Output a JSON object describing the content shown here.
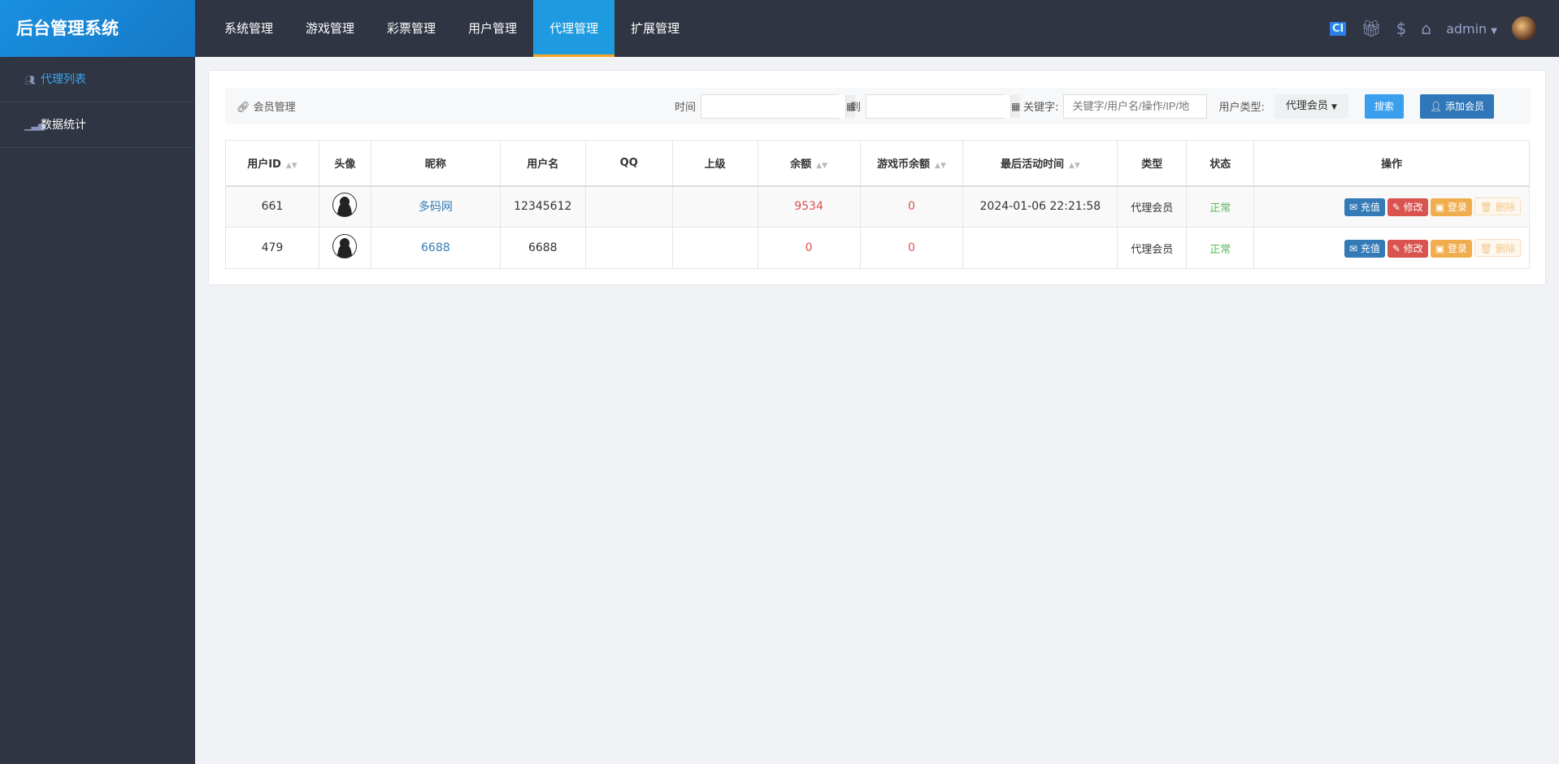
{
  "app_title": "后台管理系统",
  "nav": [
    "系统管理",
    "游戏管理",
    "彩票管理",
    "用户管理",
    "代理管理",
    "扩展管理"
  ],
  "nav_active": 4,
  "header": {
    "ci_label": "CI",
    "user": "admin"
  },
  "sidebar": {
    "items": [
      {
        "label": "代理列表",
        "icon": "users-icon"
      },
      {
        "label": "数据统计",
        "icon": "signal-icon"
      }
    ]
  },
  "toolbar": {
    "title": "会员管理",
    "time_label": "时间",
    "to_label": "到",
    "keyword_label": "关键字:",
    "keyword_placeholder": "关键字/用户名/操作/IP/地",
    "type_label": "用户类型:",
    "type_value": "代理会员",
    "search": "搜索",
    "add": "添加会员"
  },
  "table": {
    "headers": [
      "用户ID",
      "头像",
      "昵称",
      "用户名",
      "QQ",
      "上级",
      "余额",
      "游戏币余额",
      "最后活动时间",
      "类型",
      "状态",
      "操作"
    ],
    "rows": [
      {
        "id": "661",
        "nick": "多码网",
        "username": "12345612",
        "qq": "",
        "parent": "",
        "balance": "9534",
        "coin": "0",
        "last": "2024-01-06 22:21:58",
        "type": "代理会员",
        "status": "正常"
      },
      {
        "id": "479",
        "nick": "6688",
        "username": "6688",
        "qq": "",
        "parent": "",
        "balance": "0",
        "coin": "0",
        "last": "",
        "type": "代理会员",
        "status": "正常"
      }
    ],
    "actions": [
      "充值",
      "修改",
      "登录",
      "删除"
    ]
  },
  "colors": {
    "accent": "#1e9be0",
    "topbar": "#2f3542",
    "danger": "#d9534f",
    "success": "#5cb85c"
  }
}
